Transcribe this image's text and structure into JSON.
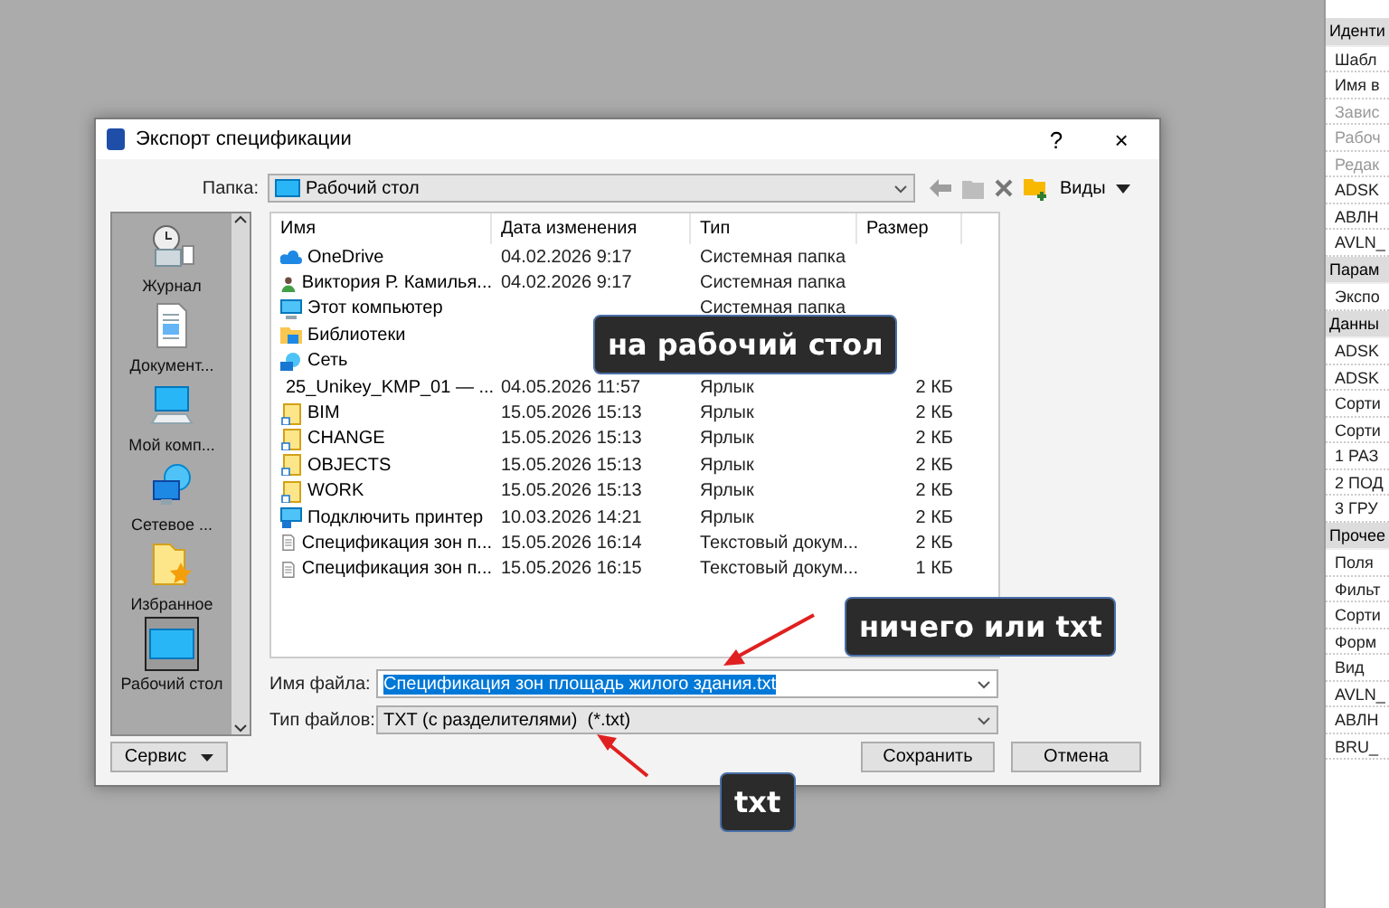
{
  "window": {
    "title": "Экспорт спецификации",
    "help": "?",
    "close": "×"
  },
  "folder": {
    "label": "Папка:",
    "value": "Рабочий стол",
    "views": "Виды"
  },
  "places": [
    {
      "label": "Журнал",
      "kind": "history",
      "selected": false
    },
    {
      "label": "Документ...",
      "kind": "document",
      "selected": false
    },
    {
      "label": "Мой комп...",
      "kind": "computer",
      "selected": false
    },
    {
      "label": "Сетевое ...",
      "kind": "network",
      "selected": false
    },
    {
      "label": "Избранное",
      "kind": "favorites",
      "selected": false
    },
    {
      "label": "Рабочий стол",
      "kind": "desktop",
      "selected": true
    }
  ],
  "files": {
    "columns": [
      "Имя",
      "Дата изменения",
      "Тип",
      "Размер"
    ],
    "rows": [
      {
        "kind": "cloud",
        "name": "OneDrive",
        "date": "04.02.2026 9:17",
        "type": "Системная папка"
      },
      {
        "kind": "user",
        "name": "Виктория Р. Камилья...",
        "date": "04.02.2026 9:17",
        "type": "Системная папка"
      },
      {
        "kind": "computer",
        "name": "Этот компьютер",
        "type": "Системная папка"
      },
      {
        "kind": "library",
        "name": "Библиотеки"
      },
      {
        "kind": "network",
        "name": "Сеть"
      },
      {
        "kind": "shortcut",
        "name": "25_Unikey_KMP_01 — ...",
        "date": "04.05.2026 11:57",
        "type": "Ярлык",
        "size": "2 КБ"
      },
      {
        "kind": "shortcut",
        "name": "BIM",
        "date": "15.05.2026 15:13",
        "type": "Ярлык",
        "size": "2 КБ"
      },
      {
        "kind": "shortcut",
        "name": "CHANGE",
        "date": "15.05.2026 15:13",
        "type": "Ярлык",
        "size": "2 КБ"
      },
      {
        "kind": "shortcut",
        "name": "OBJECTS",
        "date": "15.05.2026 15:13",
        "type": "Ярлык",
        "size": "2 КБ"
      },
      {
        "kind": "shortcut",
        "name": "WORK",
        "date": "15.05.2026 15:13",
        "type": "Ярлык",
        "size": "2 КБ"
      },
      {
        "kind": "printer",
        "name": "Подключить принтер",
        "date": "10.03.2026 14:21",
        "type": "Ярлык",
        "size": "2 КБ"
      },
      {
        "kind": "text",
        "name": "Спецификация зон п...",
        "date": "15.05.2026 16:14",
        "type": "Текстовый докум...",
        "size": "2 КБ"
      },
      {
        "kind": "text",
        "name": "Спецификация зон п...",
        "date": "15.05.2026 16:15",
        "type": "Текстовый докум...",
        "size": "1 КБ"
      }
    ]
  },
  "file_name": {
    "label": "Имя файла:",
    "value": "Спецификация зон площадь жилого здания.txt"
  },
  "file_type": {
    "label": "Тип файлов:",
    "value": "TXT (с разделителями)  (*.txt)"
  },
  "buttons": {
    "tools": "Сервис",
    "save": "Сохранить",
    "cancel": "Отмена"
  },
  "callouts": [
    {
      "text": "на рабочий стол"
    },
    {
      "text": "ничего или txt"
    },
    {
      "text": "txt"
    }
  ],
  "properties": [
    {
      "kind": "group",
      "label": "Иденти"
    },
    {
      "kind": "row",
      "label": "Шабл",
      "disabled": false
    },
    {
      "kind": "row",
      "label": "Имя в",
      "disabled": false
    },
    {
      "kind": "row",
      "label": "Завис",
      "disabled": true
    },
    {
      "kind": "row",
      "label": "Рабоч",
      "disabled": true
    },
    {
      "kind": "row",
      "label": "Редак",
      "disabled": true
    },
    {
      "kind": "row",
      "label": "ADSK",
      "disabled": false
    },
    {
      "kind": "row",
      "label": "АВЛН",
      "disabled": false
    },
    {
      "kind": "row",
      "label": "AVLN_",
      "disabled": false
    },
    {
      "kind": "group",
      "label": "Парам"
    },
    {
      "kind": "row",
      "label": "Экспо",
      "disabled": false
    },
    {
      "kind": "group",
      "label": "Данны"
    },
    {
      "kind": "row",
      "label": "ADSK",
      "disabled": false
    },
    {
      "kind": "row",
      "label": "ADSK",
      "disabled": false
    },
    {
      "kind": "row",
      "label": "Сорти",
      "disabled": false
    },
    {
      "kind": "row",
      "label": "Сорти",
      "disabled": false
    },
    {
      "kind": "row",
      "label": "1 РАЗ",
      "disabled": false
    },
    {
      "kind": "row",
      "label": "2 ПОД",
      "disabled": false
    },
    {
      "kind": "row",
      "label": "3 ГРУ",
      "disabled": false
    },
    {
      "kind": "group",
      "label": "Прочее"
    },
    {
      "kind": "row",
      "label": "Поля",
      "disabled": false
    },
    {
      "kind": "row",
      "label": "Фильт",
      "disabled": false
    },
    {
      "kind": "row",
      "label": "Сорти",
      "disabled": false
    },
    {
      "kind": "row",
      "label": "Форм",
      "disabled": false
    },
    {
      "kind": "row",
      "label": "Вид",
      "disabled": false
    },
    {
      "kind": "row",
      "label": "AVLN_",
      "disabled": false
    },
    {
      "kind": "row",
      "label": "АВЛН",
      "disabled": false
    },
    {
      "kind": "row",
      "label": "BRU_",
      "disabled": false
    }
  ]
}
